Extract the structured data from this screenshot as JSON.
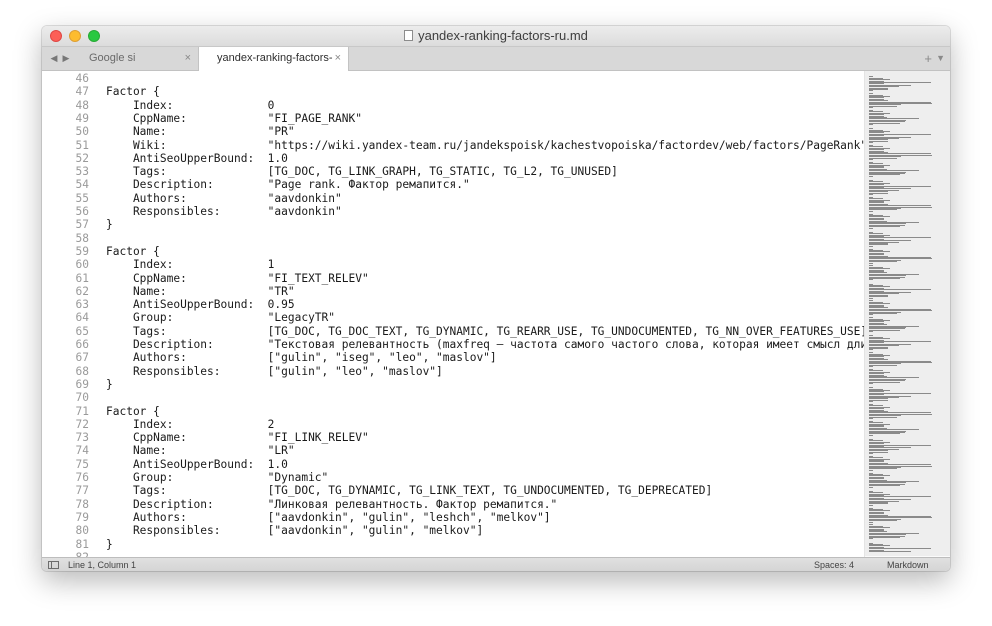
{
  "window": {
    "title": "yandex-ranking-factors-ru.md"
  },
  "tabs": [
    {
      "label": "Google si Yandex.html",
      "close": "×"
    },
    {
      "label": "yandex-ranking-factors-ru.md",
      "close": "×"
    }
  ],
  "tabbar": {
    "nav_left": "◀",
    "nav_right": "▶",
    "new_tab": "+",
    "menu": "▼"
  },
  "editor": {
    "first_line": 46,
    "lines": [
      "",
      "Factor {",
      "    Index:              0",
      "    CppName:            \"FI_PAGE_RANK\"",
      "    Name:               \"PR\"",
      "    Wiki:               \"https://wiki.yandex-team.ru/jandekspoisk/kachestvopoiska/factordev/web/factors/PageRank\"",
      "    AntiSeoUpperBound:  1.0",
      "    Tags:               [TG_DOC, TG_LINK_GRAPH, TG_STATIC, TG_L2, TG_UNUSED]",
      "    Description:        \"Page rank. Фактор ремапится.\"",
      "    Authors:            \"aavdonkin\"",
      "    Responsibles:       \"aavdonkin\"",
      "}",
      "",
      "Factor {",
      "    Index:              1",
      "    CppName:            \"FI_TEXT_RELEV\"",
      "    Name:               \"TR\"",
      "    AntiSeoUpperBound:  0.95",
      "    Group:              \"LegacyTR\"",
      "    Tags:               [TG_DOC, TG_DOC_TEXT, TG_DYNAMIC, TG_REARR_USE, TG_UNDOCUMENTED, TG_NN_OVER_FEATURES_USE]",
      "    Description:        \"Текстовая релевантность (maxfreq — частота самого частого слова, которая имеет смысл длин",
      "    Authors:            [\"gulin\", \"iseg\", \"leo\", \"maslov\"]",
      "    Responsibles:       [\"gulin\", \"leo\", \"maslov\"]",
      "}",
      "",
      "Factor {",
      "    Index:              2",
      "    CppName:            \"FI_LINK_RELEV\"",
      "    Name:               \"LR\"",
      "    AntiSeoUpperBound:  1.0",
      "    Group:              \"Dynamic\"",
      "    Tags:               [TG_DOC, TG_DYNAMIC, TG_LINK_TEXT, TG_UNDOCUMENTED, TG_DEPRECATED]",
      "    Description:        \"Линковая релевантность. Фактор ремапится.\"",
      "    Authors:            [\"aavdonkin\", \"gulin\", \"leshch\", \"melkov\"]",
      "    Responsibles:       [\"aavdonkin\", \"gulin\", \"melkov\"]",
      "}",
      ""
    ]
  },
  "statusbar": {
    "position": "Line 1, Column 1",
    "spaces": "Spaces: 4",
    "syntax": "Markdown"
  }
}
